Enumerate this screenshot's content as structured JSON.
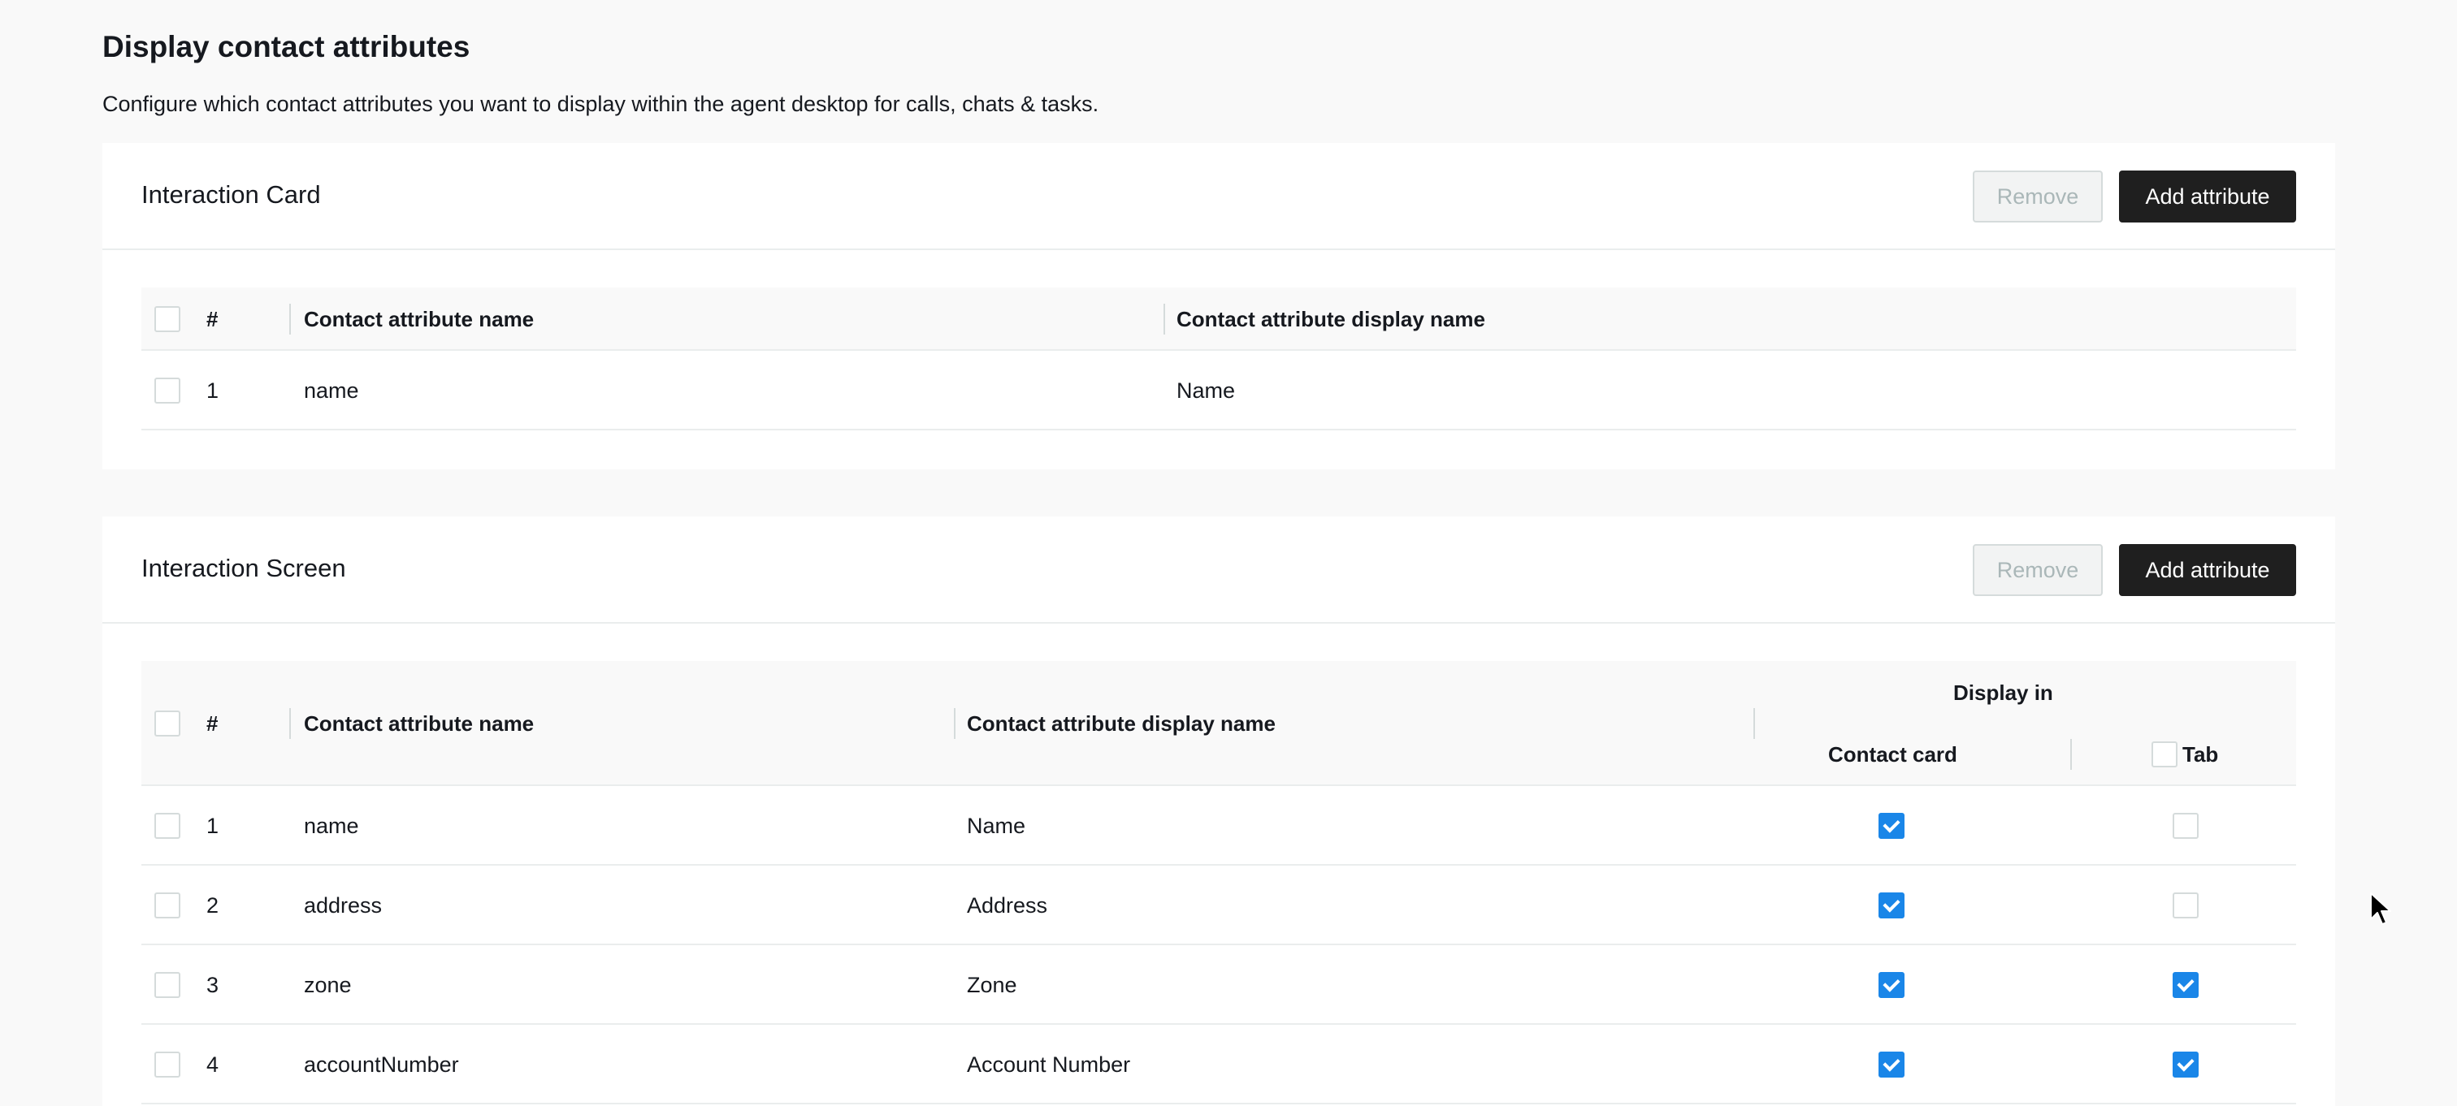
{
  "page": {
    "title": "Display contact attributes",
    "description": "Configure which contact attributes you want to display within the agent desktop for calls, chats & tasks."
  },
  "interaction_card": {
    "title": "Interaction Card",
    "remove_label": "Remove",
    "add_label": "Add attribute",
    "columns": {
      "index": "#",
      "name": "Contact attribute name",
      "display_name": "Contact attribute display name"
    },
    "rows": [
      {
        "index": "1",
        "name": "name",
        "display_name": "Name"
      }
    ]
  },
  "interaction_screen": {
    "title": "Interaction Screen",
    "remove_label": "Remove",
    "add_label": "Add attribute",
    "columns": {
      "index": "#",
      "name": "Contact attribute name",
      "display_name": "Contact attribute display name",
      "display_in": "Display in",
      "contact_card": "Contact card",
      "tab": "Tab"
    },
    "rows": [
      {
        "index": "1",
        "name": "name",
        "display_name": "Name",
        "contact_card": true,
        "tab": false
      },
      {
        "index": "2",
        "name": "address",
        "display_name": "Address",
        "contact_card": true,
        "tab": false
      },
      {
        "index": "3",
        "name": "zone",
        "display_name": "Zone",
        "contact_card": true,
        "tab": true
      },
      {
        "index": "4",
        "name": "accountNumber",
        "display_name": "Account Number",
        "contact_card": true,
        "tab": true
      }
    ]
  },
  "colors": {
    "accent": "#1a86e8",
    "primary_button": "#1f1f1f",
    "page_background": "#f9f9f9"
  }
}
